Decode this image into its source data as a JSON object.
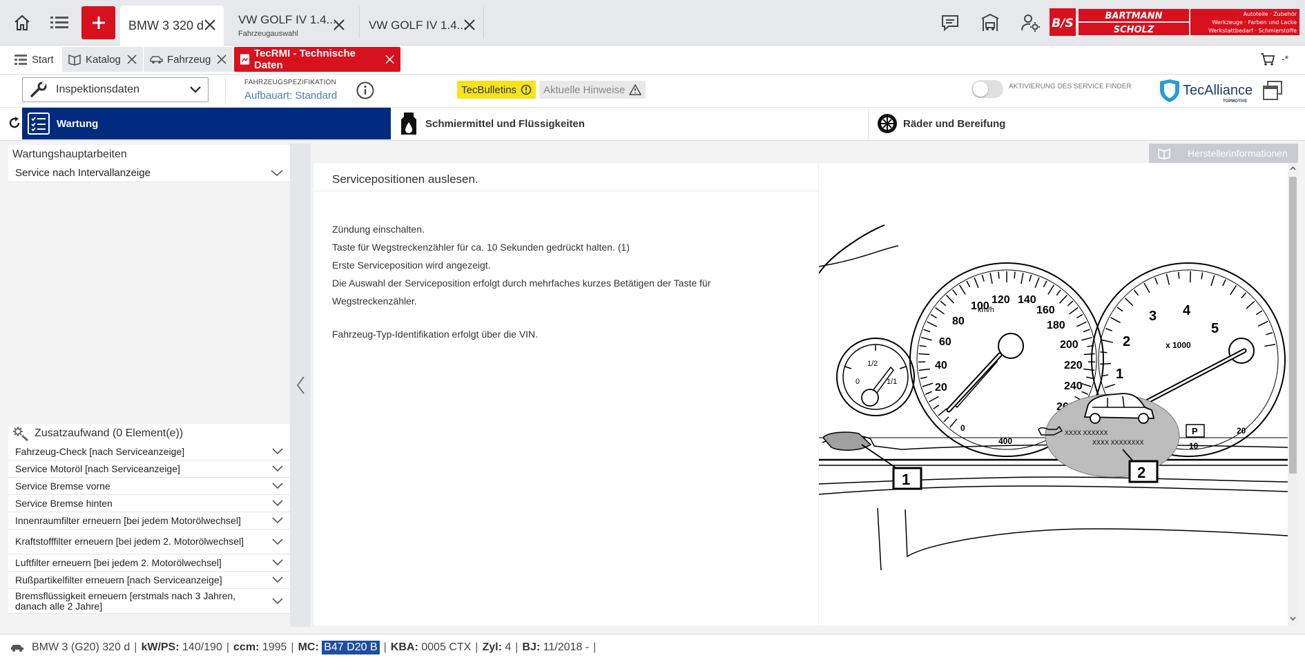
{
  "topbar": {
    "vehicle_tabs": [
      {
        "title": "BMW 3 320 d",
        "subtitle": ""
      },
      {
        "title": "VW GOLF IV 1.4...",
        "subtitle": "Fahrzeugauswahl"
      },
      {
        "title": "VW GOLF IV 1.4...",
        "subtitle": ""
      }
    ],
    "brand": {
      "logo_letters": "B/S",
      "line1": "BARTMANN",
      "line2": "SCHOLZ",
      "tagline1": "Autoteile · Zubehör",
      "tagline2": "Werkzeuge · Farben und Lacke",
      "tagline3": "Werkstattbedarf · Schmierstoffe"
    }
  },
  "module_tabs": [
    {
      "label": "Start",
      "icon": "list-icon"
    },
    {
      "label": "Katalog",
      "icon": "book-icon"
    },
    {
      "label": "Fahrzeug",
      "icon": "car-icon"
    },
    {
      "label": "TecRMI - Technische Daten",
      "icon": "document-icon"
    }
  ],
  "cart_suffix": "-*",
  "infobar": {
    "dropdown_label": "Inspektionsdaten",
    "spec_label": "FAHRZEUGSPEZIFIKATION",
    "spec_value": "Aufbauart: Standard",
    "tecbulletins": "TecBulletins",
    "hinweise": "Aktuelle Hinweise",
    "toggle_label": "AKTIVIERUNG DES SERVICE FINDER",
    "toggle_on": false,
    "tecalliance": "TecAlliance",
    "tecalliance_sub": "TOPMOTIVE"
  },
  "categories": [
    {
      "label": "Wartung",
      "active": true
    },
    {
      "label": "Schmiermittel und Flüssigkeiten",
      "active": false
    },
    {
      "label": "Räder und Bereifung",
      "active": false
    }
  ],
  "left": {
    "main_heading": "Wartungshauptarbeiten",
    "main_item": "Service nach Intervallanzeige",
    "extra_heading": "Zusatzaufwand (0 Element(e))",
    "extra_items": [
      "Fahrzeug-Check [nach Serviceanzeige]",
      "Service Motoröl [nach Serviceanzeige]",
      "Service Bremse vorne",
      "Service Bremse hinten",
      "Innenraumfilter erneuern [bei jedem Motorölwechsel]",
      "Kraftstofffilter erneuern [bei jedem 2. Motorölwechsel]",
      "Luftfilter erneuern [bei jedem 2. Motorölwechsel]",
      "Rußpartikelfilter erneuern [nach Serviceanzeige]",
      "Bremsflüssigkeit erneuern [erstmals nach 3 Jahren, danach alle 2 Jahre]"
    ]
  },
  "hersteller_button": "Herstellerinformationen",
  "content": {
    "title": "Servicepositionen auslesen.",
    "lines": [
      "Zündung einschalten.",
      "Taste für Wegstreckenzähler für ca. 10 Sekunden gedrückt halten. (1)",
      "Erste Serviceposition wird angezeigt.",
      "Die Auswahl der Serviceposition erfolgt durch mehrfaches kurzes Betätigen der Taste für",
      "Wegstreckenzähler.",
      "Fahrzeug-Typ-Identifikation erfolgt über die VIN."
    ]
  },
  "diagram": {
    "speed_unit": "km/h",
    "speed_ticks": [
      "0",
      "20",
      "40",
      "60",
      "80",
      "100",
      "120",
      "140",
      "160",
      "180",
      "200",
      "220",
      "240",
      "260",
      "400"
    ],
    "rpm_unit": "x 1000",
    "rpm_ticks": [
      "0",
      "1",
      "2",
      "3",
      "4",
      "5",
      "10",
      "20"
    ],
    "fuel_ticks": [
      "0",
      "1/2",
      "1/1"
    ],
    "gear": "P",
    "display_line1": "XXXX   XXXXXX",
    "display_line2": "XXXX XXXXXXXX",
    "callout1": "1",
    "callout2": "2"
  },
  "statusbar": {
    "vehicle": "BMW 3 (G20) 320 d",
    "kw_label": "kW/PS:",
    "kw_value": "140/190",
    "ccm_label": "ccm:",
    "ccm_value": "1995",
    "mc_label": "MC:",
    "mc_value": "B47 D20 B",
    "kba_label": "KBA:",
    "kba_value": "0005 CTX",
    "zyl_label": "Zyl:",
    "zyl_value": "4",
    "bj_label": "BJ:",
    "bj_value": "11/2018 -",
    "separator": "|"
  },
  "colors": {
    "accent_red": "#d7111d",
    "accent_blue": "#002b7f",
    "bulletin_yellow": "#f7e31b",
    "mc_highlight": "#1f4e9c"
  }
}
